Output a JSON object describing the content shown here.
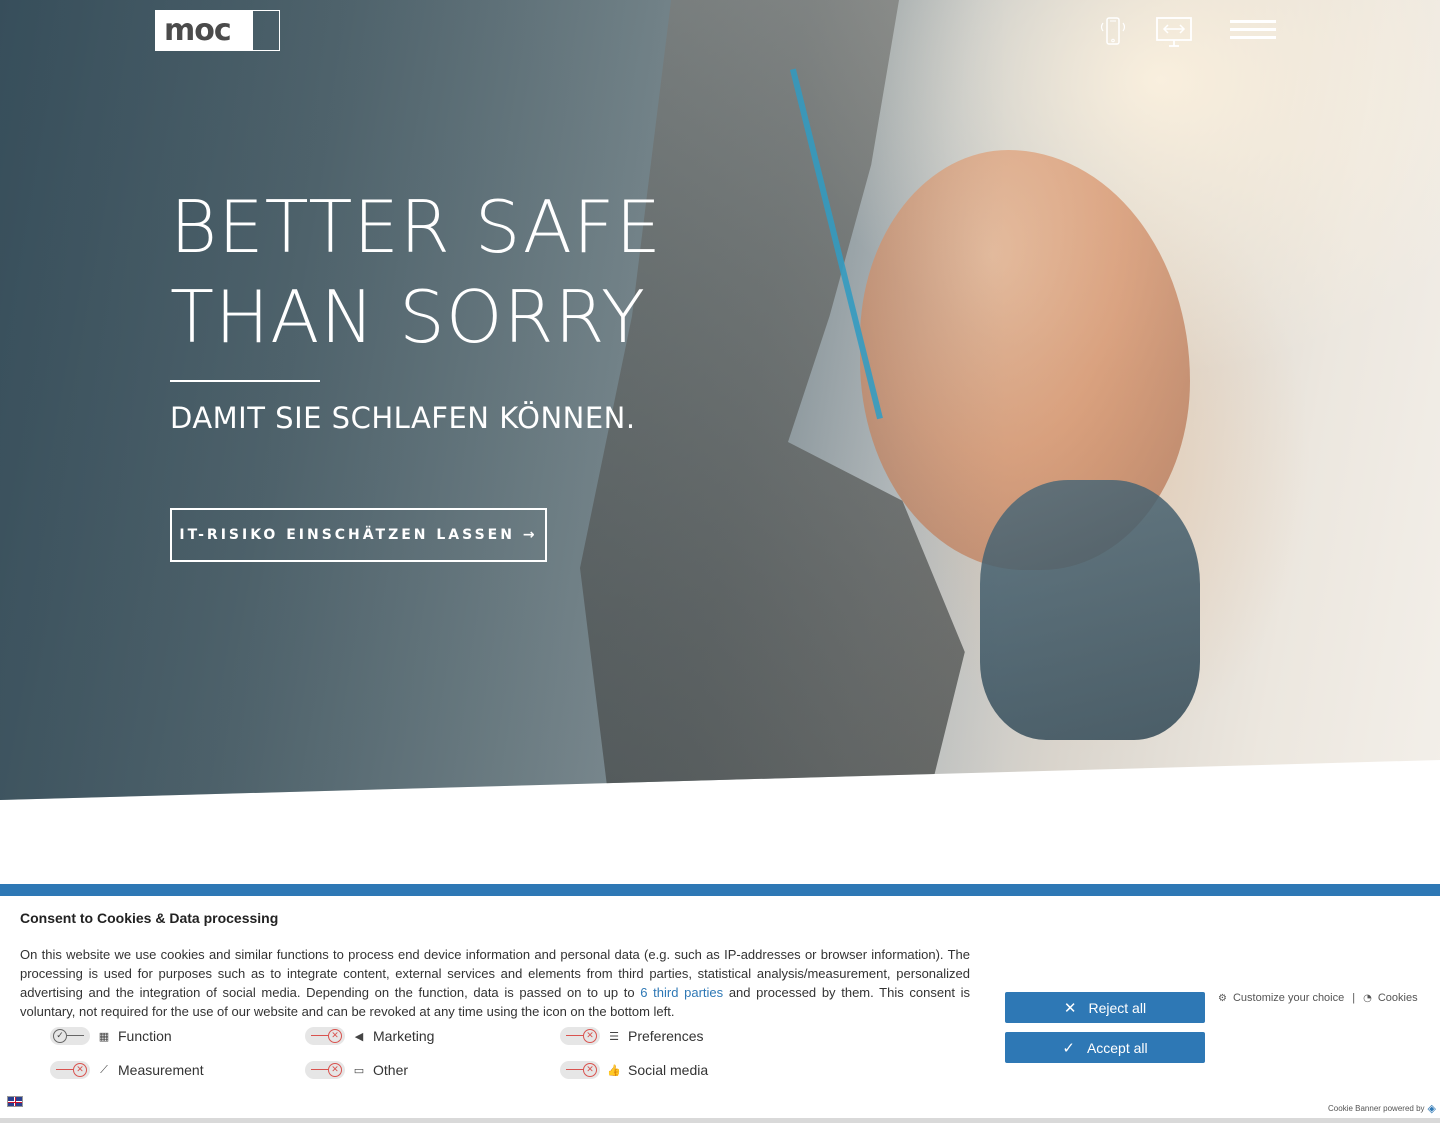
{
  "brand": {
    "logo_text": "moc"
  },
  "hero": {
    "title_line1": "BETTER SAFE",
    "title_line2": "THAN SORRY",
    "subtitle": "DAMIT SIE SCHLAFEN KÖNNEN.",
    "cta_label": "IT-RISIKO EINSCHÄTZEN LASSEN →"
  },
  "nav": {
    "icons": [
      "mobile-device-icon",
      "desktop-monitor-icon",
      "hamburger-menu-icon"
    ]
  },
  "cookie_banner": {
    "title": "Consent to Cookies & Data processing",
    "text_before_link": "On this website we use cookies and similar functions to process end device information and personal data (e.g. such as IP-addresses or browser information). The processing is used for purposes such as to integrate content, external services and elements from third parties, statistical analysis/measurement, personalized advertising and the integration of social media. Depending on the function, data is passed on to up to ",
    "link_text": "6 third parties",
    "text_after_link": " and processed by them. This consent is voluntary, not required for the use of our website and can be revoked at any time using the icon on the bottom left.",
    "categories": [
      {
        "label": "Function",
        "icon": "function-grid-icon",
        "enabled": true
      },
      {
        "label": "Marketing",
        "icon": "megaphone-icon",
        "enabled": false
      },
      {
        "label": "Preferences",
        "icon": "sliders-icon",
        "enabled": false
      },
      {
        "label": "Measurement",
        "icon": "chart-line-icon",
        "enabled": false
      },
      {
        "label": "Other",
        "icon": "chat-bubbles-icon",
        "enabled": false
      },
      {
        "label": "Social media",
        "icon": "thumbs-up-icon",
        "enabled": false
      }
    ],
    "reject_label": "Reject all",
    "accept_label": "Accept all",
    "customize_label": "Customize your choice",
    "separator": "|",
    "cookies_label": "Cookies",
    "powered_by": "Cookie Banner powered by",
    "accent_color": "#2e78b5"
  }
}
